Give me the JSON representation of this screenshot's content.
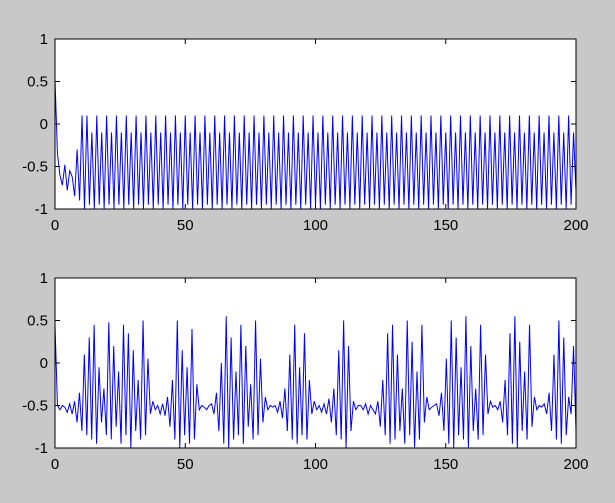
{
  "colors": {
    "figure_bg": "#c8c8c8",
    "axes_bg": "#ffffff",
    "line": "#0000ff",
    "axis": "#000000"
  },
  "chart_data": [
    {
      "type": "line",
      "title": "",
      "xlabel": "",
      "ylabel": "",
      "xlim": [
        0,
        200
      ],
      "ylim": [
        -1,
        1
      ],
      "xticks": [
        0,
        50,
        100,
        150,
        200
      ],
      "yticks": [
        -1,
        -0.5,
        0,
        0.5,
        1
      ],
      "xtick_labels": [
        "0",
        "50",
        "100",
        "150",
        "200"
      ],
      "ytick_labels": [
        "-1",
        "-0.5",
        "0",
        "0.5",
        "1"
      ],
      "grid": false,
      "series": [
        {
          "values": [
            0.52,
            -0.35,
            -0.6,
            -0.72,
            -0.48,
            -0.78,
            -0.55,
            -0.62,
            -0.85,
            -0.3,
            -0.9,
            0.1,
            -1,
            0.1,
            -0.95,
            -0.1,
            -1,
            0.1,
            -0.95,
            -0.1,
            -1,
            0.1,
            -0.95,
            -0.1,
            -1,
            0.1,
            -0.95,
            -0.1,
            -1,
            0.1,
            -0.95,
            -0.1,
            -1,
            0.1,
            -0.95,
            -0.1,
            -1,
            0.1,
            -0.95,
            -0.1,
            -1,
            0.1,
            -0.95,
            -0.1,
            -1,
            0.1,
            -0.95,
            -0.1,
            -1,
            0.1,
            -0.95,
            -0.1,
            -1,
            0.1,
            -0.95,
            -0.1,
            -1,
            0.1,
            -0.95,
            -0.1,
            -1,
            0.1,
            -0.95,
            -0.1,
            -1,
            0.1,
            -0.95,
            -0.1,
            -1,
            0.1,
            -0.95,
            -0.1,
            -1,
            0.1,
            -0.95,
            -0.1,
            -1,
            0.1,
            -0.95,
            -0.1,
            -1,
            0.1,
            -0.95,
            -0.1,
            -1,
            0.1,
            -0.95,
            -0.1,
            -1,
            0.1,
            -0.95,
            -0.1,
            -1,
            0.1,
            -0.95,
            -0.1,
            -1,
            0.1,
            -0.95,
            -0.1,
            -1,
            0.1,
            -0.95,
            -0.1,
            -1,
            0.1,
            -0.95,
            -0.1,
            -1,
            0.1,
            -0.95,
            -0.1,
            -1,
            0.1,
            -0.95,
            -0.1,
            -1,
            0.1,
            -0.95,
            -0.1,
            -1,
            0.1,
            -0.95,
            -0.1,
            -1,
            0.1,
            -0.95,
            -0.1,
            -1,
            0.1,
            -0.95,
            -0.1,
            -1,
            0.1,
            -0.95,
            -0.1,
            -1,
            0.1,
            -0.95,
            -0.1,
            -1,
            0.1,
            -0.95,
            -0.1,
            -1,
            0.1,
            -0.95,
            -0.1,
            -1,
            0.1,
            -0.95,
            -0.1,
            -1,
            0.1,
            -0.95,
            -0.1,
            -1,
            0.1,
            -0.95,
            -0.1,
            -1,
            0.1,
            -0.95,
            -0.1,
            -1,
            0.1,
            -0.95,
            -0.1,
            -1,
            0.1,
            -0.95,
            -0.1,
            -1,
            0.1,
            -0.95,
            -0.1,
            -1,
            0.1,
            -0.95,
            -0.1,
            -1,
            0.1,
            -0.95,
            -0.1,
            -1,
            0.1,
            -0.95,
            -0.1,
            -1,
            0.1,
            -0.95,
            -0.1,
            -1,
            0.1,
            -0.95,
            -0.1,
            -1,
            0.1,
            -0.95,
            -0.1,
            -1,
            0.1,
            -0.95,
            -0.1,
            -1,
            0.1,
            -0.95,
            -0.1,
            -1,
            0.1,
            -0.95,
            -0.1,
            -0.8
          ]
        }
      ]
    },
    {
      "type": "line",
      "title": "",
      "xlabel": "",
      "ylabel": "",
      "xlim": [
        0,
        200
      ],
      "ylim": [
        -1,
        1
      ],
      "xticks": [
        0,
        50,
        100,
        150,
        200
      ],
      "yticks": [
        -1,
        -0.5,
        0,
        0.5,
        1
      ],
      "xtick_labels": [
        "0",
        "50",
        "100",
        "150",
        "200"
      ],
      "ytick_labels": [
        "-1",
        "-0.5",
        "0",
        "0.5",
        "1"
      ],
      "grid": false,
      "series": [
        {
          "values": [
            0.45,
            -0.5,
            -0.55,
            -0.5,
            -0.52,
            -0.58,
            -0.48,
            -0.6,
            -0.45,
            -0.7,
            -0.35,
            -0.8,
            0.1,
            -0.85,
            0.3,
            -0.9,
            0.45,
            -0.95,
            -0.05,
            -0.7,
            -0.3,
            -0.85,
            0.48,
            -0.9,
            0.2,
            -0.75,
            -0.1,
            -0.95,
            0.45,
            -0.85,
            0.35,
            -1,
            0.15,
            -0.8,
            -0.2,
            -0.9,
            0.5,
            -0.85,
            0.05,
            -0.6,
            -0.45,
            -0.55,
            -0.5,
            -0.6,
            -0.48,
            -0.62,
            -0.4,
            -0.75,
            -0.2,
            -0.9,
            0.5,
            -1,
            0.15,
            -0.85,
            -0.05,
            -0.95,
            0.4,
            -0.9,
            -0.25,
            -0.55,
            -0.5,
            -0.52,
            -0.55,
            -0.5,
            -0.48,
            -0.6,
            -0.35,
            -0.8,
            0.0,
            -0.95,
            0.55,
            -1,
            0.3,
            -0.9,
            -0.1,
            -0.85,
            0.45,
            -0.95,
            0.2,
            -0.75,
            -0.25,
            -0.9,
            0.5,
            -0.85,
            0.05,
            -0.7,
            -0.4,
            -0.55,
            -0.5,
            -0.52,
            -0.5,
            -0.58,
            -0.45,
            -0.65,
            -0.3,
            -0.8,
            0.1,
            -0.9,
            0.45,
            -0.95,
            -0.05,
            -0.85,
            0.35,
            -0.9,
            -0.2,
            -0.6,
            -0.45,
            -0.55,
            -0.5,
            -0.58,
            -0.48,
            -0.6,
            -0.42,
            -0.7,
            -0.3,
            -0.85,
            0.15,
            -0.9,
            0.5,
            -1,
            0.2,
            -0.8,
            -0.45,
            -0.55,
            -0.5,
            -0.5,
            -0.55,
            -0.48,
            -0.6,
            -0.5,
            -0.55,
            -0.6,
            -0.45,
            -0.75,
            -0.2,
            -0.85,
            0.35,
            -0.95,
            0.45,
            -0.9,
            0.1,
            -0.8,
            -0.3,
            -0.95,
            0.5,
            -0.85,
            0.25,
            -1,
            -0.1,
            -0.9,
            0.45,
            -0.7,
            -0.4,
            -0.55,
            -0.52,
            -0.5,
            -0.48,
            -0.62,
            -0.35,
            -0.8,
            0.05,
            -0.95,
            0.5,
            -1,
            0.3,
            -0.85,
            -0.05,
            -0.9,
            0.55,
            -1,
            0.2,
            -0.8,
            -0.3,
            -0.9,
            0.45,
            -0.85,
            0.1,
            -0.6,
            -0.45,
            -0.52,
            -0.5,
            -0.55,
            -0.45,
            -0.7,
            -0.2,
            -0.85,
            0.35,
            -0.95,
            0.55,
            -1,
            0.25,
            -0.8,
            -0.1,
            -0.9,
            0.45,
            -0.75,
            -0.4,
            -0.55,
            -0.5,
            -0.52,
            -0.48,
            -0.6,
            -0.35,
            -0.8,
            0.1,
            -0.9,
            0.5,
            -0.95,
            0.3,
            -0.85,
            -0.4,
            -0.6,
            0.2,
            -0.8
          ]
        }
      ]
    }
  ]
}
